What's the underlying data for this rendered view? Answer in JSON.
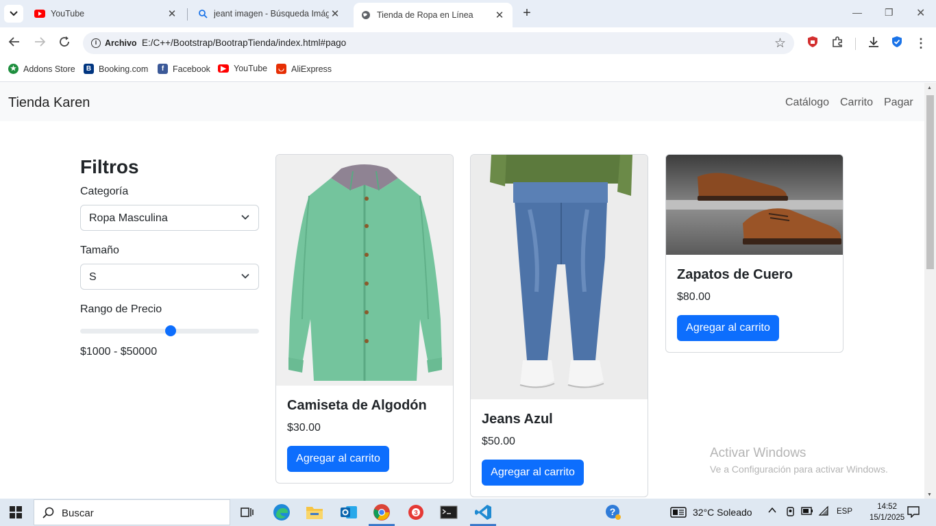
{
  "browser": {
    "tabs": [
      {
        "title": "YouTube",
        "active": false
      },
      {
        "title": "jeant imagen - Búsqueda Imágen",
        "active": false
      },
      {
        "title": "Tienda de Ropa en Línea",
        "active": true
      }
    ],
    "address": {
      "chip": "Archivo",
      "url": "E:/C++/Bootstrap/BootrapTienda/index.html#pago"
    },
    "bookmarks": [
      {
        "label": "Addons Store",
        "icon": "addons-store-icon"
      },
      {
        "label": "Booking.com",
        "icon": "booking-icon"
      },
      {
        "label": "Facebook",
        "icon": "facebook-icon"
      },
      {
        "label": "YouTube",
        "icon": "youtube-icon"
      },
      {
        "label": "AliExpress",
        "icon": "aliexpress-icon"
      }
    ]
  },
  "site": {
    "brand": "Tienda Karen",
    "nav": [
      "Catálogo",
      "Carrito",
      "Pagar"
    ]
  },
  "filters": {
    "title": "Filtros",
    "category_label": "Categoría",
    "category_value": "Ropa Masculina",
    "size_label": "Tamaño",
    "size_value": "S",
    "price_label": "Rango de Precio",
    "price_slider_fraction": 0.5,
    "price_range_text": "$1000 - $50000"
  },
  "products": [
    {
      "name": "Camiseta de Algodón",
      "price": "$30.00",
      "button": "Agregar al carrito"
    },
    {
      "name": "Jeans Azul",
      "price": "$50.00",
      "button": "Agregar al carrito"
    },
    {
      "name": "Zapatos de Cuero",
      "price": "$80.00",
      "button": "Agregar al carrito"
    }
  ],
  "watermark": {
    "line1": "Activar Windows",
    "line2": "Ve a Configuración para activar Windows."
  },
  "taskbar": {
    "search_placeholder": "Buscar",
    "weather": "32°C  Soleado",
    "language": "ESP",
    "time": "14:52",
    "date": "15/1/2025"
  },
  "colors": {
    "primary": "#0d6efd",
    "navbar_bg": "#f8f9fa",
    "tabbar_bg": "#e8eef7"
  }
}
